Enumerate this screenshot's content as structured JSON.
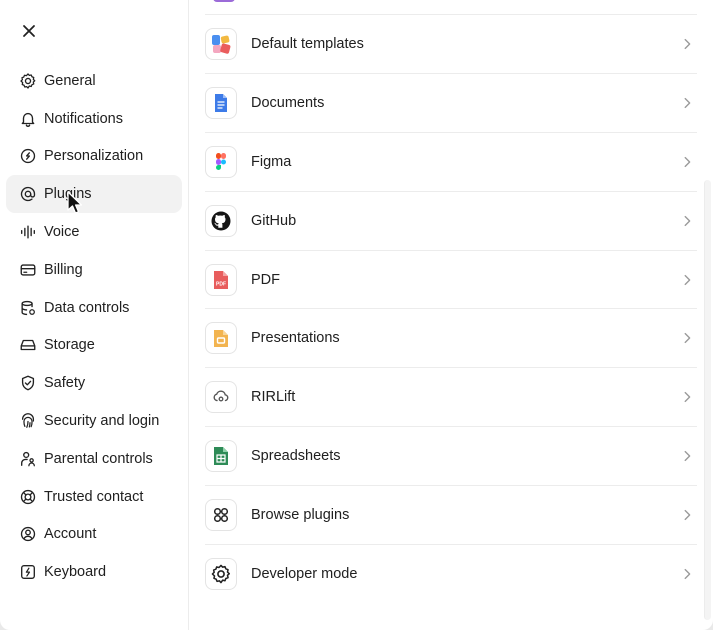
{
  "sidebar": {
    "items": [
      {
        "label": "General",
        "icon": "gear-icon"
      },
      {
        "label": "Notifications",
        "icon": "bell-icon"
      },
      {
        "label": "Personalization",
        "icon": "personalization-icon"
      },
      {
        "label": "Plugins",
        "icon": "at-sign-icon",
        "active": true
      },
      {
        "label": "Voice",
        "icon": "waveform-icon"
      },
      {
        "label": "Billing",
        "icon": "credit-card-icon"
      },
      {
        "label": "Data controls",
        "icon": "database-icon"
      },
      {
        "label": "Storage",
        "icon": "storage-icon"
      },
      {
        "label": "Safety",
        "icon": "shield-icon"
      },
      {
        "label": "Security and login",
        "icon": "fingerprint-icon"
      },
      {
        "label": "Parental controls",
        "icon": "family-icon"
      },
      {
        "label": "Trusted contact",
        "icon": "lifebuoy-icon"
      },
      {
        "label": "Account",
        "icon": "user-circle-icon"
      },
      {
        "label": "Keyboard",
        "icon": "keyboard-icon"
      }
    ]
  },
  "plugins": {
    "items": [
      {
        "label": "Default templates",
        "icon": "templates-icon"
      },
      {
        "label": "Documents",
        "icon": "document-icon"
      },
      {
        "label": "Figma",
        "icon": "figma-icon"
      },
      {
        "label": "GitHub",
        "icon": "github-icon"
      },
      {
        "label": "PDF",
        "icon": "pdf-icon"
      },
      {
        "label": "Presentations",
        "icon": "presentation-icon"
      },
      {
        "label": "RIRLift",
        "icon": "rirlift-icon"
      },
      {
        "label": "Spreadsheets",
        "icon": "spreadsheet-icon"
      },
      {
        "label": "Browse plugins",
        "icon": "grid-icon"
      },
      {
        "label": "Developer mode",
        "icon": "gear-icon"
      }
    ],
    "pdf_badge": "PDF"
  },
  "colors": {
    "active_bg": "#f2f2f2",
    "divider": "#ececec",
    "text": "#202020"
  }
}
